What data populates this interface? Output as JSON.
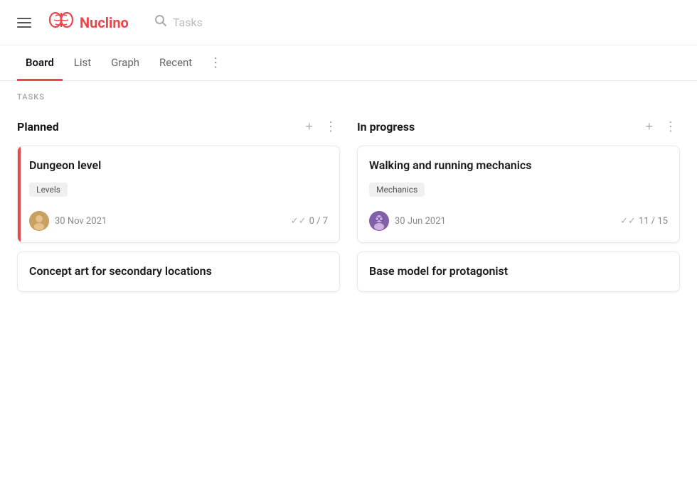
{
  "header": {
    "hamburger_label": "menu",
    "logo_icon": "🧠",
    "logo_name": "Nuclino",
    "search_placeholder": "Tasks"
  },
  "nav": {
    "tabs": [
      {
        "id": "board",
        "label": "Board",
        "active": true
      },
      {
        "id": "list",
        "label": "List",
        "active": false
      },
      {
        "id": "graph",
        "label": "Graph",
        "active": false
      },
      {
        "id": "recent",
        "label": "Recent",
        "active": false
      }
    ],
    "more_label": "⋮"
  },
  "section_label": "TASKS",
  "columns": [
    {
      "id": "planned",
      "title": "Planned",
      "add_label": "+",
      "more_label": "⋮",
      "cards": [
        {
          "id": "card-1",
          "title": "Dungeon level",
          "tag": "Levels",
          "has_accent": true,
          "date": "30 Nov 2021",
          "progress": "0 / 7",
          "avatar_type": "man",
          "avatar_initials": "👤"
        },
        {
          "id": "card-2",
          "title": "Concept art for secondary locations",
          "tag": null,
          "has_accent": false,
          "date": null,
          "progress": null,
          "avatar_type": null
        }
      ]
    },
    {
      "id": "in-progress",
      "title": "In progress",
      "add_label": "+",
      "more_label": "⋮",
      "cards": [
        {
          "id": "card-3",
          "title": "Walking and running mechanics",
          "tag": "Mechanics",
          "has_accent": false,
          "date": "30 Jun 2021",
          "progress": "11 / 15",
          "avatar_type": "woman",
          "avatar_initials": "👤"
        },
        {
          "id": "card-4",
          "title": "Base model for protagonist",
          "tag": null,
          "has_accent": false,
          "date": null,
          "progress": null,
          "avatar_type": null
        }
      ]
    }
  ]
}
